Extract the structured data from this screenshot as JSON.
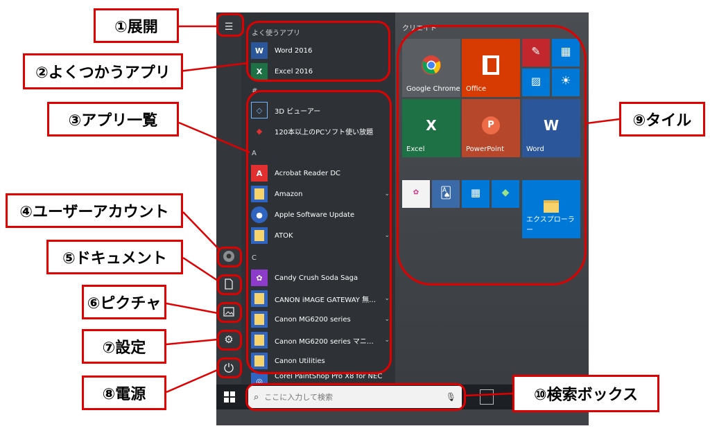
{
  "start_menu": {
    "frequent_header": "よく使うアプリ",
    "frequent_apps": [
      {
        "label": "Word 2016"
      },
      {
        "label": "Excel 2016"
      }
    ],
    "sections": [
      "#",
      "A",
      "C"
    ],
    "apps": [
      {
        "label": "3D ビューアー"
      },
      {
        "label": "120本以上のPCソフト使い放題"
      },
      {
        "label": "Acrobat Reader DC"
      },
      {
        "label": "Amazon"
      },
      {
        "label": "Apple Software Update"
      },
      {
        "label": "ATOK"
      },
      {
        "label": "Candy Crush Soda Saga"
      },
      {
        "label": "CANON iMAGE GATEWAY 無料…"
      },
      {
        "label": "Canon MG6200 series"
      },
      {
        "label": "Canon MG6200 series マニュアル"
      },
      {
        "label": "Canon Utilities"
      },
      {
        "label": "Corel PaintShop Pro X8 for NEC"
      }
    ],
    "tiles_header": "クリエイト",
    "tiles": [
      {
        "label": "Google Chrome"
      },
      {
        "label": "Office"
      },
      {
        "label": "Excel"
      },
      {
        "label": "PowerPoint"
      },
      {
        "label": "Word"
      },
      {
        "label": "エクスプローラー"
      }
    ]
  },
  "search": {
    "placeholder": "ここに入力して検索"
  },
  "callouts": {
    "expand": "①展開",
    "frequent": "②よくつかうアプリ",
    "app_list": "③アプリ一覧",
    "account": "④ユーザーアカウント",
    "documents": "⑤ドキュメント",
    "pictures": "⑥ピクチャ",
    "settings": "⑦設定",
    "power": "⑧電源",
    "tiles": "⑨タイル",
    "search_box": "⑩検索ボックス"
  },
  "colors": {
    "annotation_red": "#e00000",
    "office_orange": "#d83b01",
    "excel_green": "#1e7145",
    "word_blue": "#2b579a",
    "ppt_orange": "#b7472a",
    "tile_blue": "#0078d7"
  }
}
